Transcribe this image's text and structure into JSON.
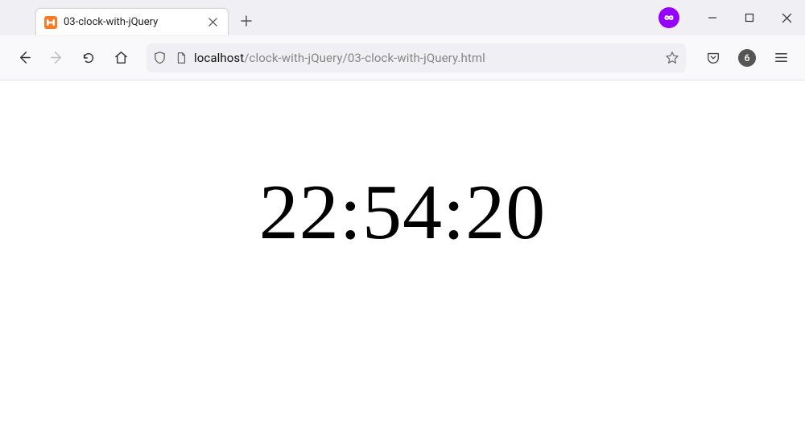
{
  "tab": {
    "title": "03-clock-with-jQuery"
  },
  "url": {
    "host": "localhost",
    "path": "/clock-with-jQuery/03-clock-with-jQuery.html"
  },
  "toolbar": {
    "notification_count": "6"
  },
  "page": {
    "clock_time": "22:54:20"
  }
}
